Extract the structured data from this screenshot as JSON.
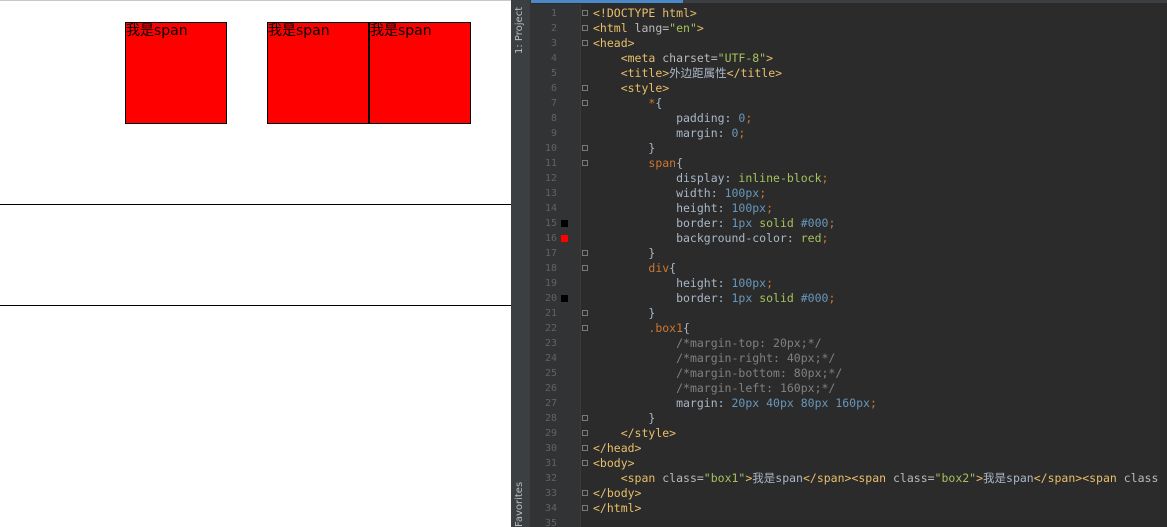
{
  "preview": {
    "spans": [
      {
        "text": "我是span",
        "left": "box1"
      },
      {
        "text": "我是span",
        "left": "box2"
      },
      {
        "text": "我是span",
        "left": "box3"
      }
    ]
  },
  "ide": {
    "sidebar": {
      "project_label": "1: Project",
      "favorites_label": "Favorites"
    },
    "swatch_colors": {
      "black": "#000000",
      "red": "#ff0000"
    },
    "lines": [
      {
        "n": "1",
        "t": [
          [
            "tg",
            "<!DOCTYPE html>"
          ]
        ]
      },
      {
        "n": "2",
        "t": [
          [
            "tg",
            "<html "
          ],
          [
            "at",
            "lang="
          ],
          [
            "st",
            "\"en\""
          ],
          [
            "tg",
            ">"
          ]
        ]
      },
      {
        "n": "3",
        "t": [
          [
            "tg",
            "<head>"
          ]
        ]
      },
      {
        "n": "4",
        "t": [
          [
            "pr",
            "    "
          ],
          [
            "tg",
            "<meta "
          ],
          [
            "at",
            "charset="
          ],
          [
            "st",
            "\"UTF-8\""
          ],
          [
            "tg",
            ">"
          ]
        ]
      },
      {
        "n": "5",
        "t": [
          [
            "pr",
            "    "
          ],
          [
            "tg",
            "<title>"
          ],
          [
            "pr",
            "外边距属性"
          ],
          [
            "tg",
            "</title>"
          ]
        ]
      },
      {
        "n": "6",
        "t": [
          [
            "pr",
            "    "
          ],
          [
            "tg",
            "<style>"
          ]
        ]
      },
      {
        "n": "7",
        "t": [
          [
            "pr",
            "        "
          ],
          [
            "sel",
            "*"
          ],
          [
            "pr",
            "{"
          ]
        ]
      },
      {
        "n": "8",
        "t": [
          [
            "pr",
            "            padding: "
          ],
          [
            "nm",
            "0"
          ],
          [
            "pu",
            ";"
          ]
        ]
      },
      {
        "n": "9",
        "t": [
          [
            "pr",
            "            margin: "
          ],
          [
            "nm",
            "0"
          ],
          [
            "pu",
            ";"
          ]
        ]
      },
      {
        "n": "10",
        "t": [
          [
            "pr",
            "        }"
          ]
        ]
      },
      {
        "n": "11",
        "t": [
          [
            "pr",
            "        "
          ],
          [
            "sel",
            "span"
          ],
          [
            "pr",
            "{"
          ]
        ]
      },
      {
        "n": "12",
        "t": [
          [
            "pr",
            "            display: "
          ],
          [
            "kw",
            "inline-block"
          ],
          [
            "pu",
            ";"
          ]
        ]
      },
      {
        "n": "13",
        "t": [
          [
            "pr",
            "            width: "
          ],
          [
            "nm",
            "100px"
          ],
          [
            "pu",
            ";"
          ]
        ]
      },
      {
        "n": "14",
        "t": [
          [
            "pr",
            "            height: "
          ],
          [
            "nm",
            "100px"
          ],
          [
            "pu",
            ";"
          ]
        ]
      },
      {
        "n": "15",
        "t": [
          [
            "pr",
            "            border: "
          ],
          [
            "nm",
            "1px "
          ],
          [
            "kw",
            "solid "
          ],
          [
            "nm",
            "#000"
          ],
          [
            "pu",
            ";"
          ]
        ],
        "swatch": "black"
      },
      {
        "n": "16",
        "t": [
          [
            "pr",
            "            background-color: "
          ],
          [
            "kw",
            "red"
          ],
          [
            "pu",
            ";"
          ]
        ],
        "swatch": "red"
      },
      {
        "n": "17",
        "t": [
          [
            "pr",
            "        }"
          ]
        ]
      },
      {
        "n": "18",
        "t": [
          [
            "pr",
            "        "
          ],
          [
            "sel",
            "div"
          ],
          [
            "pr",
            "{"
          ]
        ]
      },
      {
        "n": "19",
        "t": [
          [
            "pr",
            "            height: "
          ],
          [
            "nm",
            "100px"
          ],
          [
            "pu",
            ";"
          ]
        ]
      },
      {
        "n": "20",
        "t": [
          [
            "pr",
            "            border: "
          ],
          [
            "nm",
            "1px "
          ],
          [
            "kw",
            "solid "
          ],
          [
            "nm",
            "#000"
          ],
          [
            "pu",
            ";"
          ]
        ],
        "swatch": "black"
      },
      {
        "n": "21",
        "t": [
          [
            "pr",
            "        }"
          ]
        ]
      },
      {
        "n": "22",
        "t": [
          [
            "pr",
            "        "
          ],
          [
            "sel",
            ".box1"
          ],
          [
            "pr",
            "{"
          ]
        ]
      },
      {
        "n": "23",
        "t": [
          [
            "pr",
            "            "
          ],
          [
            "cm",
            "/*margin-top: 20px;*/"
          ]
        ]
      },
      {
        "n": "24",
        "t": [
          [
            "pr",
            "            "
          ],
          [
            "cm",
            "/*margin-right: 40px;*/"
          ]
        ]
      },
      {
        "n": "25",
        "t": [
          [
            "pr",
            "            "
          ],
          [
            "cm",
            "/*margin-bottom: 80px;*/"
          ]
        ]
      },
      {
        "n": "26",
        "t": [
          [
            "pr",
            "            "
          ],
          [
            "cm",
            "/*margin-left: 160px;*/"
          ]
        ]
      },
      {
        "n": "27",
        "t": [
          [
            "pr",
            "            margin: "
          ],
          [
            "nm",
            "20px 40px 80px 160px"
          ],
          [
            "pu",
            ";"
          ]
        ]
      },
      {
        "n": "28",
        "t": [
          [
            "pr",
            "        }"
          ]
        ]
      },
      {
        "n": "29",
        "t": [
          [
            "pr",
            "    "
          ],
          [
            "tg",
            "</style>"
          ]
        ]
      },
      {
        "n": "30",
        "t": [
          [
            "tg",
            "</head>"
          ]
        ]
      },
      {
        "n": "31",
        "t": [
          [
            "tg",
            "<body>"
          ]
        ]
      },
      {
        "n": "32",
        "t": [
          [
            "pr",
            "    "
          ],
          [
            "tg",
            "<span "
          ],
          [
            "at",
            "class="
          ],
          [
            "st",
            "\"box1\""
          ],
          [
            "tg",
            ">"
          ],
          [
            "pr",
            "我是span"
          ],
          [
            "tg",
            "</span><span "
          ],
          [
            "at",
            "class="
          ],
          [
            "st",
            "\"box2\""
          ],
          [
            "tg",
            ">"
          ],
          [
            "pr",
            "我是span"
          ],
          [
            "tg",
            "</span><span "
          ],
          [
            "at",
            "class"
          ]
        ]
      },
      {
        "n": "33",
        "t": [
          [
            "tg",
            "</body>"
          ]
        ]
      },
      {
        "n": "34",
        "t": [
          [
            "tg",
            "</html>"
          ]
        ]
      },
      {
        "n": "35",
        "t": []
      }
    ],
    "fold_lines": [
      "1",
      "2",
      "3",
      "6",
      "7",
      "10",
      "11",
      "17",
      "18",
      "21",
      "22",
      "28",
      "29",
      "30",
      "31",
      "33",
      "34"
    ]
  }
}
